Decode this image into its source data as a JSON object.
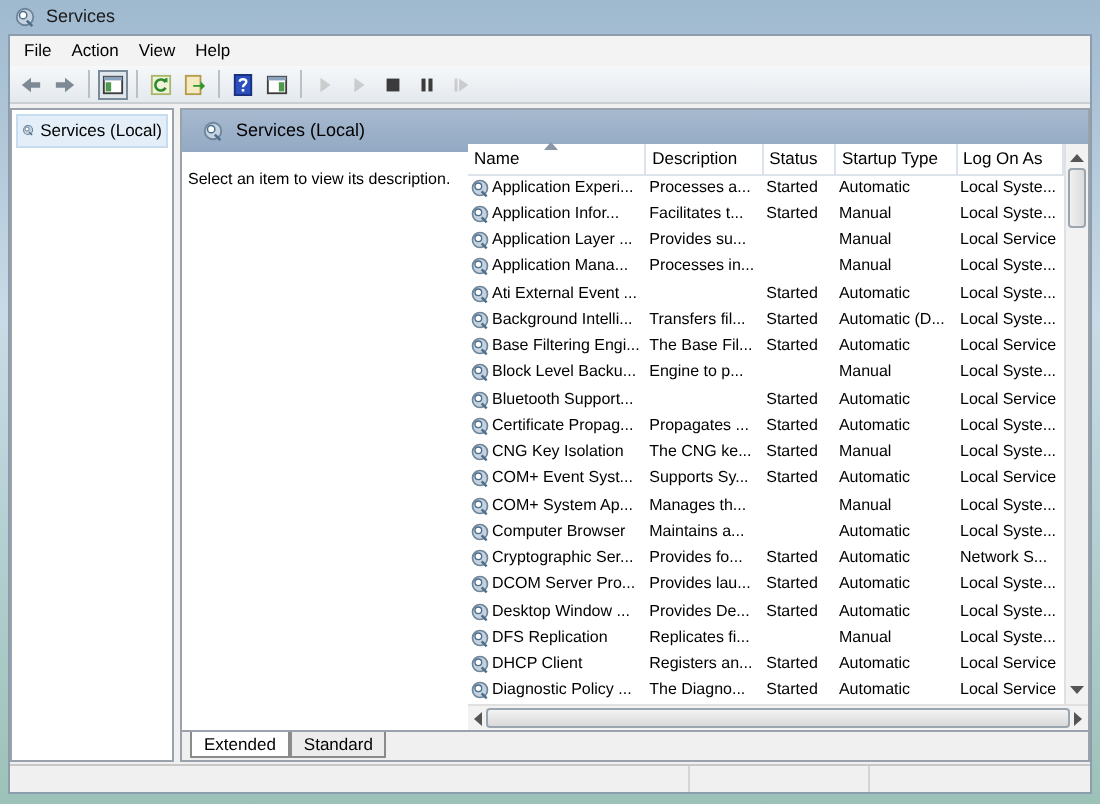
{
  "window": {
    "title": "Services"
  },
  "menu": [
    {
      "label": "File"
    },
    {
      "label": "Action"
    },
    {
      "label": "View"
    },
    {
      "label": "Help"
    }
  ],
  "toolbar": [
    {
      "kind": "back",
      "disabled": false
    },
    {
      "kind": "forward",
      "disabled": false
    },
    {
      "kind": "separator"
    },
    {
      "kind": "tree",
      "disabled": false,
      "pressed": true
    },
    {
      "kind": "separator"
    },
    {
      "kind": "refresh",
      "disabled": false
    },
    {
      "kind": "export",
      "disabled": false
    },
    {
      "kind": "separator"
    },
    {
      "kind": "help",
      "disabled": false
    },
    {
      "kind": "pane",
      "disabled": false
    },
    {
      "kind": "separator"
    },
    {
      "kind": "play",
      "disabled": true
    },
    {
      "kind": "play",
      "disabled": true
    },
    {
      "kind": "stop",
      "disabled": false
    },
    {
      "kind": "pause",
      "disabled": false
    },
    {
      "kind": "restart",
      "disabled": true
    }
  ],
  "tree": [
    {
      "label": "Services (Local)",
      "selected": true
    }
  ],
  "panel": {
    "title": "Services (Local)",
    "description": "Select an item to view its description."
  },
  "table": {
    "columns": [
      {
        "label": "Name",
        "sorted": true
      },
      {
        "label": "Description"
      },
      {
        "label": "Status"
      },
      {
        "label": "Startup Type"
      },
      {
        "label": "Log On As"
      }
    ],
    "rows": [
      [
        "Application Experi...",
        "Processes a...",
        "Started",
        "Automatic",
        "Local Syste..."
      ],
      [
        "Application Infor...",
        "Facilitates t...",
        "Started",
        "Manual",
        "Local Syste..."
      ],
      [
        "Application Layer ...",
        "Provides su...",
        "",
        "Manual",
        "Local Service"
      ],
      [
        "Application Mana...",
        "Processes in...",
        "",
        "Manual",
        "Local Syste..."
      ],
      [
        "Ati External Event ...",
        "",
        "Started",
        "Automatic",
        "Local Syste..."
      ],
      [
        "Background Intelli...",
        "Transfers fil...",
        "Started",
        "Automatic (D...",
        "Local Syste..."
      ],
      [
        "Base Filtering Engi...",
        "The Base Fil...",
        "Started",
        "Automatic",
        "Local Service"
      ],
      [
        "Block Level Backu...",
        "Engine to p...",
        "",
        "Manual",
        "Local Syste..."
      ],
      [
        "Bluetooth Support...",
        "",
        "Started",
        "Automatic",
        "Local Service"
      ],
      [
        "Certificate Propag...",
        "Propagates ...",
        "Started",
        "Automatic",
        "Local Syste..."
      ],
      [
        "CNG Key Isolation",
        "The CNG ke...",
        "Started",
        "Manual",
        "Local Syste..."
      ],
      [
        "COM+ Event Syst...",
        "Supports Sy...",
        "Started",
        "Automatic",
        "Local Service"
      ],
      [
        "COM+ System Ap...",
        "Manages th...",
        "",
        "Manual",
        "Local Syste..."
      ],
      [
        "Computer Browser",
        "Maintains a...",
        "",
        "Automatic",
        "Local Syste..."
      ],
      [
        "Cryptographic Ser...",
        "Provides fo...",
        "Started",
        "Automatic",
        "Network S..."
      ],
      [
        "DCOM Server Pro...",
        "Provides lau...",
        "Started",
        "Automatic",
        "Local Syste..."
      ],
      [
        "Desktop Window ...",
        "Provides De...",
        "Started",
        "Automatic",
        "Local Syste..."
      ],
      [
        "DFS Replication",
        "Replicates fi...",
        "",
        "Manual",
        "Local Syste..."
      ],
      [
        "DHCP Client",
        "Registers an...",
        "Started",
        "Automatic",
        "Local Service"
      ],
      [
        "Diagnostic Policy ...",
        "The Diagno...",
        "Started",
        "Automatic",
        "Local Service"
      ]
    ]
  },
  "tabs": [
    {
      "label": "Extended",
      "selected": true
    },
    {
      "label": "Standard",
      "selected": false
    }
  ]
}
